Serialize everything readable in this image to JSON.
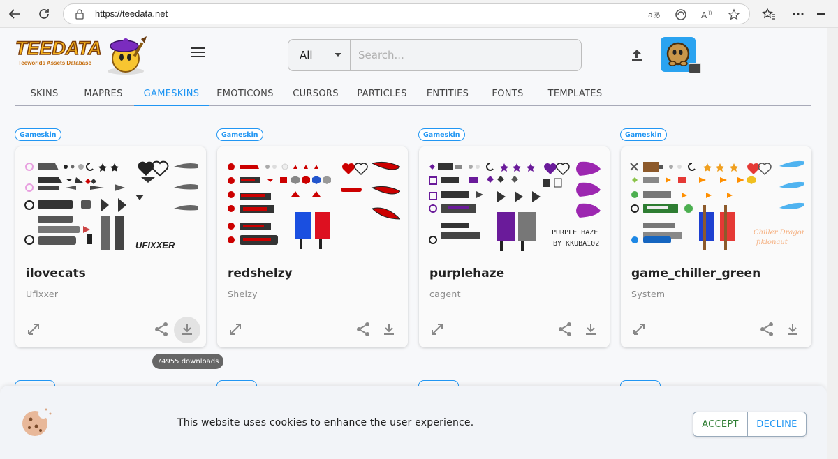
{
  "browser": {
    "url": "https://teedata.net",
    "icons": [
      "back-icon",
      "refresh-icon",
      "lock-icon",
      "translate-icon",
      "reader-icon",
      "read-aloud-icon",
      "favorite-star-icon",
      "favorites-icon",
      "more-icon",
      "minimize-icon"
    ]
  },
  "header": {
    "logo_text": "TEEDATA",
    "logo_tagline": "Teeworlds Assets Database",
    "search": {
      "category": "All",
      "placeholder": "Search..."
    }
  },
  "tabs": [
    {
      "label": "SKINS"
    },
    {
      "label": "MAPRES"
    },
    {
      "label": "GAMESKINS",
      "active": true
    },
    {
      "label": "EMOTICONS"
    },
    {
      "label": "CURSORS"
    },
    {
      "label": "PARTICLES"
    },
    {
      "label": "ENTITIES"
    },
    {
      "label": "FONTS"
    },
    {
      "label": "TEMPLATES"
    }
  ],
  "cards": [
    {
      "chip": "Gameskin",
      "title": "ilovecats",
      "author": "Ufixxer",
      "art_text": "UFIXXER",
      "accent": "#222222"
    },
    {
      "chip": "Gameskin",
      "title": "redshelzy",
      "author": "Shelzy",
      "art_text": "",
      "accent": "#d01020"
    },
    {
      "chip": "Gameskin",
      "title": "purplehaze",
      "author": "cagent",
      "art_text": "PURPLE HAZE",
      "art_text2": "BY KKUBA102",
      "accent": "#6a1b9a"
    },
    {
      "chip": "Gameskin",
      "title": "game_chiller_green",
      "author": "System",
      "art_text": "Chiller Dragon",
      "art_text2": "fiklonaut",
      "accent": "#3aa0e8"
    }
  ],
  "tooltip": "74955 downloads",
  "cookie": {
    "message": "This website uses cookies to enhance the user experience.",
    "accept": "ACCEPT",
    "decline": "DECLINE"
  },
  "colors": {
    "primary": "#2196f3",
    "accept": "#2e7d32",
    "avatar_bg": "#2aa3f0"
  }
}
